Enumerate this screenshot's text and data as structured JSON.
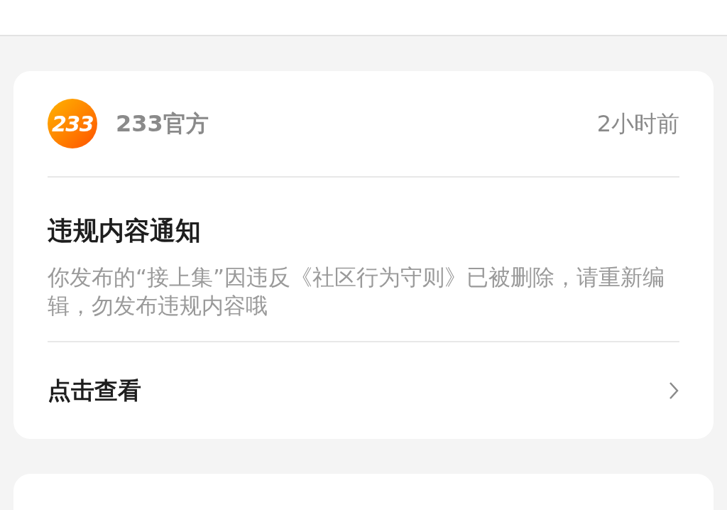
{
  "notifications": [
    {
      "logo_text": "233",
      "sender": "233官方",
      "time": "2小时前",
      "title": "违规内容通知",
      "message": "你发布的“接上集”因违反《社区行为守则》已被删除，请重新编辑，勿发布违规内容哦",
      "action": "点击查看"
    }
  ]
}
